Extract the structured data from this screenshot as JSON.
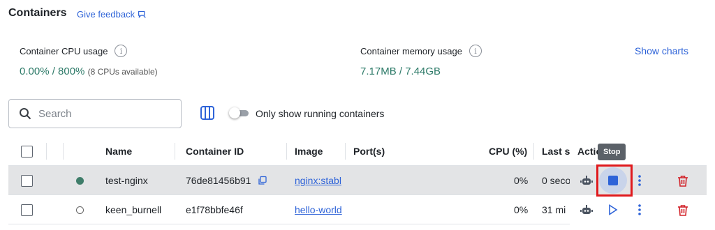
{
  "header": {
    "title": "Containers",
    "feedback_label": "Give feedback"
  },
  "stats": {
    "cpu_label": "Container CPU usage",
    "cpu_value": "0.00% / 800%",
    "cpu_note": "(8 CPUs available)",
    "memory_label": "Container memory usage",
    "memory_value": "7.17MB / 7.44GB",
    "show_charts": "Show charts"
  },
  "toolbar": {
    "search_placeholder": "Search",
    "search_value": "",
    "running_only_label": "Only show running containers",
    "running_only": false
  },
  "table": {
    "columns": [
      "Name",
      "Container ID",
      "Image",
      "Port(s)",
      "CPU (%)",
      "Last s",
      "Actio"
    ],
    "rows": [
      {
        "status": "running",
        "name": "test-nginx",
        "container_id": "76de81456b91",
        "image": "nginx:stabl",
        "ports": "",
        "cpu": "0%",
        "last_started": "0 seco",
        "action": "stop"
      },
      {
        "status": "stopped",
        "name": "keen_burnell",
        "container_id": "e1f78bbfe46f",
        "image": "hello-world",
        "ports": "",
        "cpu": "0%",
        "last_started": "31 mi",
        "action": "start"
      }
    ]
  },
  "tooltip": {
    "text": "Stop"
  },
  "colors": {
    "accent": "#2e63d8",
    "running": "#3f7d6a",
    "delete": "#d2232a",
    "highlight": "#e0191c"
  }
}
